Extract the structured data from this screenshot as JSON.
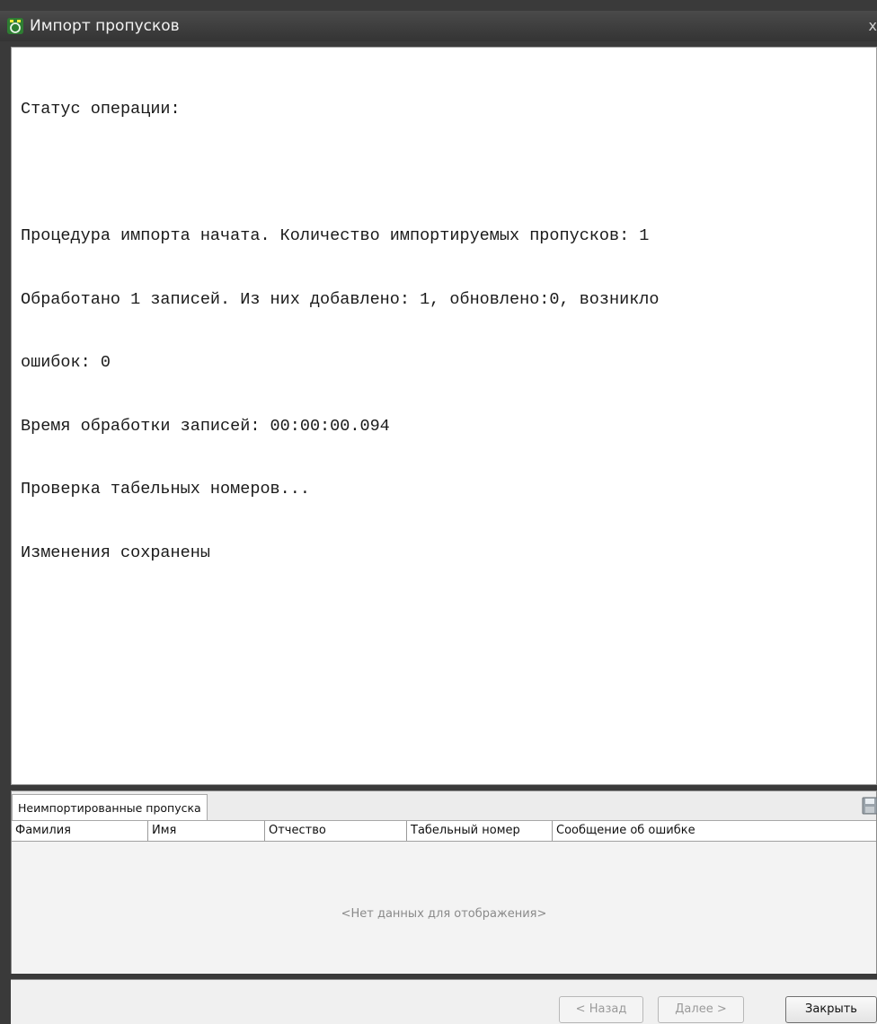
{
  "window": {
    "title": "Импорт пропусков",
    "close_glyph": "x"
  },
  "status": {
    "lines": [
      "Статус операции:",
      "",
      "Процедура импорта начата. Количество импортируемых пропусков: 1",
      "Обработано 1 записей. Из них добавлено: 1, обновлено:0, возникло",
      "ошибок: 0",
      "Время обработки записей: 00:00:00.094",
      "Проверка табельных номеров...",
      "Изменения сохранены"
    ]
  },
  "panel": {
    "tab_label": "Неимпортированные пропуска",
    "columns": [
      "Фамилия",
      "Имя",
      "Отчество",
      "Табельный номер",
      "Сообщение об ошибке"
    ],
    "empty_text": "<Нет данных для отображения>"
  },
  "footer": {
    "back_label": "< Назад",
    "next_label": "Далее >",
    "close_label": "Закрыть"
  },
  "colors": {
    "titlebar": "#3c3c3c",
    "text_area": "#ffffff",
    "panel": "#f0f0f0"
  }
}
